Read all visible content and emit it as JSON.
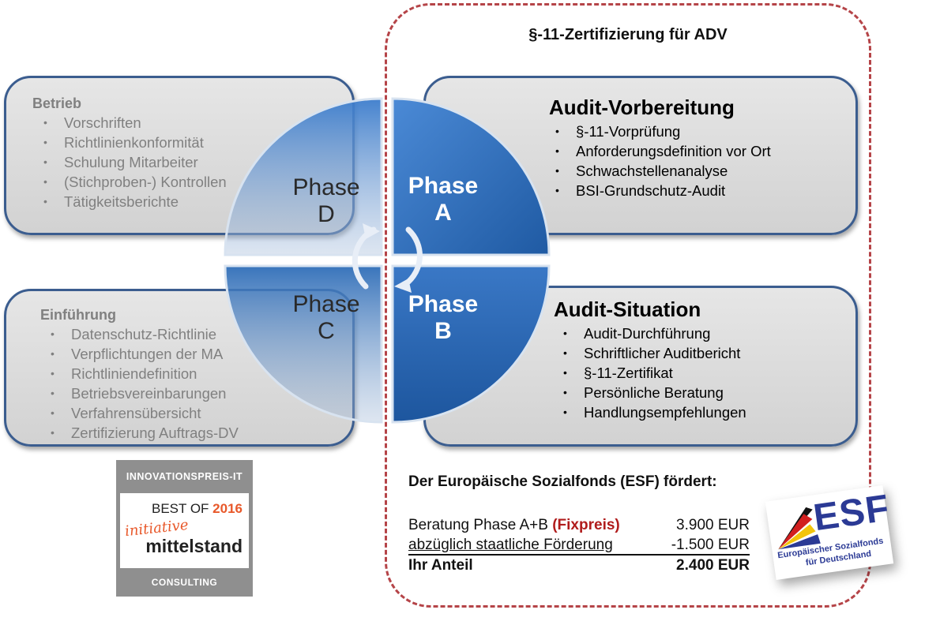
{
  "frame": {
    "title": "§-11-Zertifizierung für ADV",
    "border_color": "#b54448"
  },
  "boxes": {
    "betrieb": {
      "title": "Betrieb",
      "items": [
        "Vorschriften",
        "Richtlinienkonformität",
        "Schulung Mitarbeiter",
        "(Stichproben-) Kontrollen",
        "Tätigkeitsberichte"
      ]
    },
    "einfuehrung": {
      "title": "Einführung",
      "items": [
        "Datenschutz-Richtlinie",
        "Verpflichtungen der MA",
        "Richtliniendefinition",
        "Betriebsvereinbarungen",
        "Verfahrensübersicht",
        "Zertifizierung Auftrags-DV"
      ]
    },
    "audit_vorbereitung": {
      "title": "Audit-Vorbereitung",
      "items": [
        "§-11-Vorprüfung",
        "Anforderungsdefinition vor Ort",
        "Schwachstellenanalyse",
        "BSI-Grundschutz-Audit"
      ]
    },
    "audit_situation": {
      "title": "Audit-Situation",
      "items": [
        "Audit-Durchführung",
        "Schriftlicher Auditbericht",
        "§-11-Zertifikat",
        "Persönliche Beratung",
        "Handlungsempfehlungen"
      ]
    }
  },
  "phases": {
    "a": {
      "word": "Phase",
      "letter": "A"
    },
    "b": {
      "word": "Phase",
      "letter": "B"
    },
    "c": {
      "word": "Phase",
      "letter": "C"
    },
    "d": {
      "word": "Phase",
      "letter": "D"
    }
  },
  "colors": {
    "phase_blue": "#2f6db8",
    "box_border": "#3b5d8f",
    "fixpreis_red": "#b01c1c",
    "badge_orange": "#e8582a"
  },
  "esf": {
    "heading": "Der Europäische Sozialfonds (ESF) fördert:",
    "rows": [
      {
        "label": "Beratung Phase A+B",
        "highlight": "(Fixpreis)",
        "value": "3.900 EUR"
      },
      {
        "label": "abzüglich staatliche Förderung",
        "value": "-1.500 EUR"
      },
      {
        "label": "Ihr Anteil",
        "value": "2.400 EUR"
      }
    ],
    "logo": {
      "big": "ESF",
      "line1": "Europäischer Sozialfonds",
      "line2": "für Deutschland"
    }
  },
  "badge": {
    "top": "INNOVATIONSPREIS-IT",
    "best_of": "BEST OF",
    "year": "2016",
    "script": "initiative",
    "brand": "mittelstand",
    "bottom": "CONSULTING"
  }
}
